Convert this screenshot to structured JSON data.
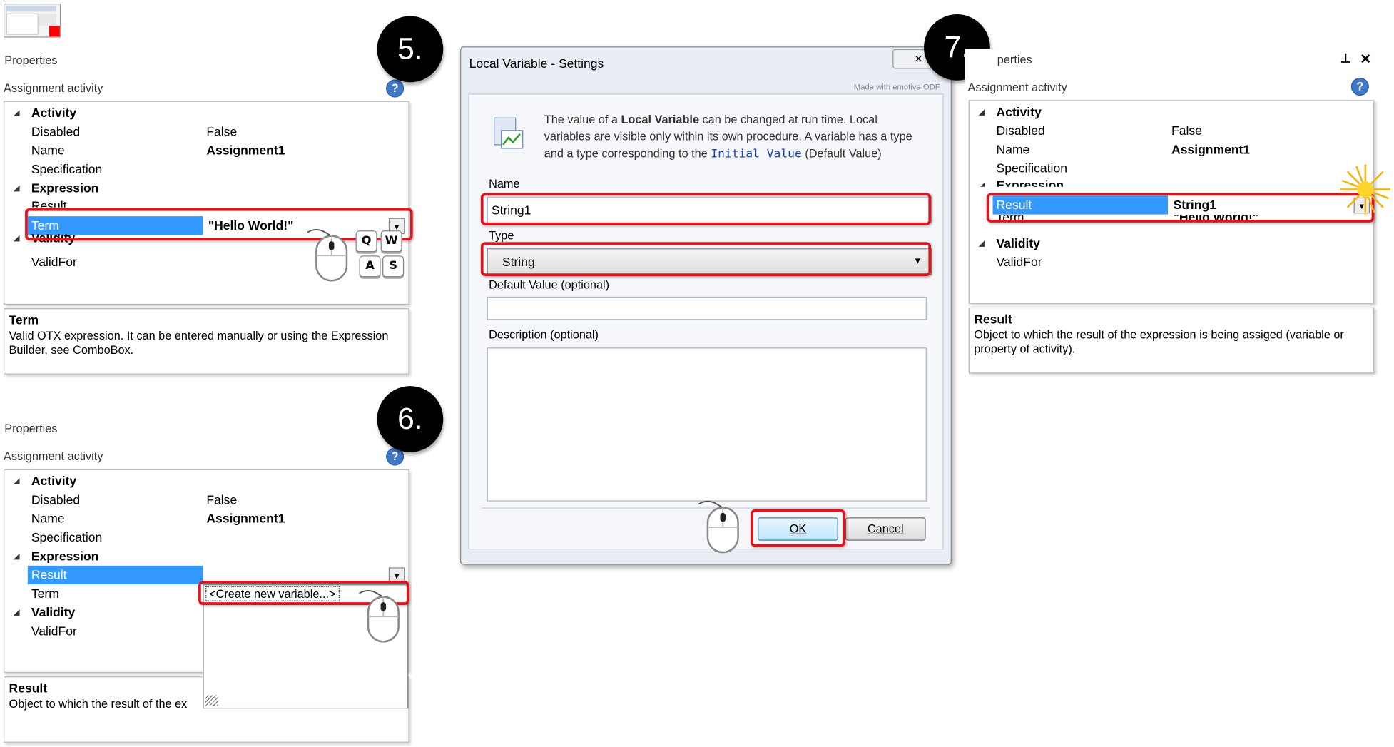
{
  "steps": {
    "step5": "5.",
    "step6": "6.",
    "step7": "7."
  },
  "panel_common": {
    "title": "Properties",
    "subtitle": "Assignment activity",
    "help_icon": "question-icon",
    "categories": {
      "activity": "Activity",
      "expression": "Expression",
      "validity": "Validity"
    },
    "labels": {
      "disabled": "Disabled",
      "name": "Name",
      "specification": "Specification",
      "result": "Result",
      "term": "Term",
      "validfor": "ValidFor"
    },
    "values": {
      "disabled": "False",
      "name": "Assignment1"
    }
  },
  "panel5": {
    "term_value": "\"Hello World!\"",
    "desc_title": "Term",
    "desc_text": "Valid OTX expression. It can be entered manually or using the Expression Builder, see ComboBox.",
    "keys": [
      "Q",
      "W",
      "A",
      "S"
    ]
  },
  "panel6": {
    "dropdown_item": "<Create new variable...>",
    "desc_title": "Result",
    "desc_text": "Object to which the result of the ex"
  },
  "panel7": {
    "title_fragment": "perties",
    "result_value": "String1",
    "term_value": "\"Hello World!\"",
    "desc_title": "Result",
    "desc_text": "Object to which the result of the expression is being assiged (variable or property of activity).",
    "pin_icon": "pin-icon",
    "close_icon": "close-icon"
  },
  "dialog": {
    "title": "Local Variable - Settings",
    "watermark": "Made with emotive ODF",
    "info_prefix": "The value of a ",
    "info_bold": "Local Variable",
    "info_mid": " can be changed at run time. Local variables are visible only within its own procedure. A variable has a type and a type corresponding to the ",
    "info_code": "Initial Value",
    "info_suffix": " (Default Value)",
    "name_label": "Name",
    "name_value": "String1",
    "type_label": "Type",
    "type_value": "String",
    "default_label": "Default Value (optional)",
    "default_value": "",
    "description_label": "Description (optional)",
    "description_value": "",
    "ok_label": "OK",
    "cancel_label": "Cancel"
  },
  "colors": {
    "selection": "#3399ff",
    "highlight": "#e0141e",
    "badge": "#000000",
    "help": "#3f78c9"
  }
}
